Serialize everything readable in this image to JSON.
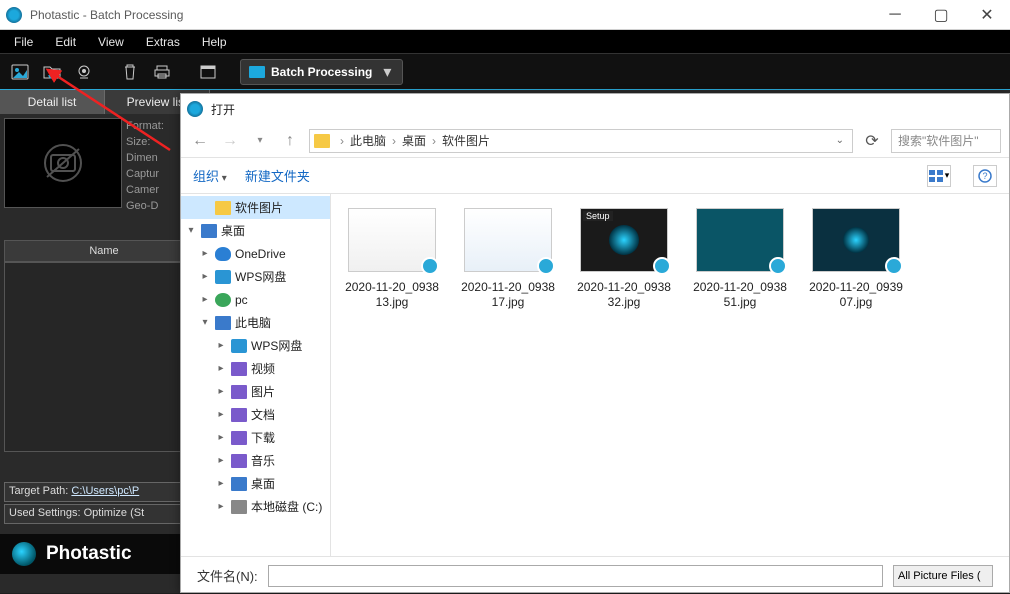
{
  "titlebar": {
    "title": "Photastic - Batch Processing"
  },
  "menu": {
    "file": "File",
    "edit": "Edit",
    "view": "View",
    "extras": "Extras",
    "help": "Help"
  },
  "toolbar": {
    "batch_label": "Batch Processing"
  },
  "left_panel": {
    "tab_detail": "Detail list",
    "tab_preview": "Preview list",
    "meta": {
      "format": "Format:",
      "size": "Size:",
      "dimen": "Dimen",
      "capture": "Captur",
      "camera": "Camer",
      "geo": "Geo-D"
    },
    "name_header": "Name",
    "target_path_label": "Target Path:",
    "target_path_value": "C:\\Users\\pc\\P",
    "used_settings_label": "Used Settings:",
    "used_settings_value": "Optimize (St",
    "brand": "Photastic"
  },
  "dialog": {
    "title": "打开",
    "breadcrumb": [
      "此电脑",
      "桌面",
      "软件图片"
    ],
    "search_placeholder": "搜索\"软件图片\"",
    "organize": "组织",
    "new_folder": "新建文件夹",
    "tree": [
      {
        "label": "软件图片",
        "icon": "folder",
        "indent": 1,
        "active": true,
        "chev": ""
      },
      {
        "label": "桌面",
        "icon": "pc",
        "indent": 0,
        "chev": "▾"
      },
      {
        "label": "OneDrive",
        "icon": "cloud",
        "indent": 1,
        "chev": "▸"
      },
      {
        "label": "WPS网盘",
        "icon": "wps",
        "indent": 1,
        "chev": "▸"
      },
      {
        "label": "pc",
        "icon": "user",
        "indent": 1,
        "chev": "▸"
      },
      {
        "label": "此电脑",
        "icon": "pc",
        "indent": 1,
        "chev": "▾"
      },
      {
        "label": "WPS网盘",
        "icon": "wps",
        "indent": 2,
        "chev": "▸"
      },
      {
        "label": "视频",
        "icon": "media",
        "indent": 2,
        "chev": "▸"
      },
      {
        "label": "图片",
        "icon": "media",
        "indent": 2,
        "chev": "▸"
      },
      {
        "label": "文档",
        "icon": "media",
        "indent": 2,
        "chev": "▸"
      },
      {
        "label": "下载",
        "icon": "media",
        "indent": 2,
        "chev": "▸"
      },
      {
        "label": "音乐",
        "icon": "media",
        "indent": 2,
        "chev": "▸"
      },
      {
        "label": "桌面",
        "icon": "pc",
        "indent": 2,
        "chev": "▸"
      },
      {
        "label": "本地磁盘 (C:)",
        "icon": "disk",
        "indent": 2,
        "chev": "▸"
      }
    ],
    "files": [
      {
        "name": "2020-11-20_093813.jpg",
        "thumb": "t1"
      },
      {
        "name": "2020-11-20_093817.jpg",
        "thumb": "t2"
      },
      {
        "name": "2020-11-20_093832.jpg",
        "thumb": "t3",
        "setup": "Setup"
      },
      {
        "name": "2020-11-20_093851.jpg",
        "thumb": "t4"
      },
      {
        "name": "2020-11-20_093907.jpg",
        "thumb": "t5"
      }
    ],
    "filename_label": "文件名(N):",
    "filter": "All Picture Files ("
  }
}
